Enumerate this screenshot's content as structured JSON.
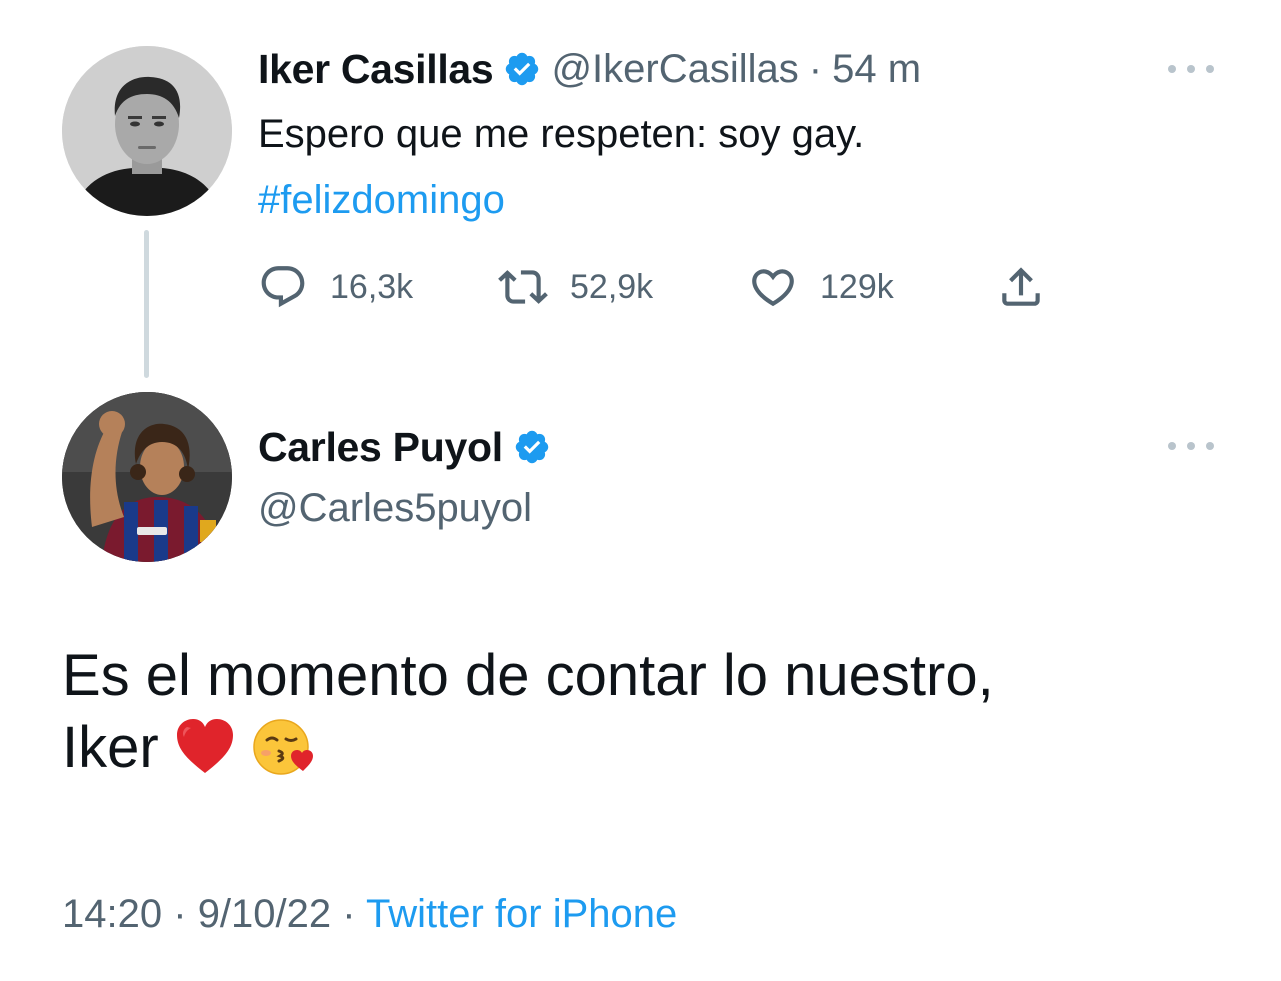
{
  "thread": {
    "parent": {
      "author_name": "Iker Casillas",
      "handle": "@IkerCasillas",
      "separator": "·",
      "time_ago": "54 m",
      "text": "Espero que me respeten: soy gay.",
      "hashtag": "#felizdomingo",
      "verified": true,
      "avatar_icon": "avatar-photo-iker",
      "stats": {
        "replies": "16,3k",
        "retweets": "52,9k",
        "likes": "129k"
      },
      "action_icons": [
        "reply-icon",
        "retweet-icon",
        "like-icon",
        "share-icon"
      ]
    },
    "reply": {
      "author_name": "Carles Puyol",
      "handle": "@Carles5puyol",
      "verified": true,
      "avatar_icon": "avatar-photo-puyol",
      "text_line1": "Es el momento de contar lo nuestro,",
      "text_line2": "Iker",
      "emojis": [
        "red-heart-emoji",
        "face-blowing-kiss-emoji"
      ],
      "timestamp_time": "14:20",
      "timestamp_sep": "·",
      "timestamp_date": "9/10/22",
      "source_sep": "·",
      "source": "Twitter for iPhone"
    }
  },
  "colors": {
    "text_primary": "#0f1419",
    "text_secondary": "#536471",
    "link_blue": "#1d9bf0",
    "thread_line": "#cfd9de",
    "verified_blue": "#1d9bf0"
  }
}
